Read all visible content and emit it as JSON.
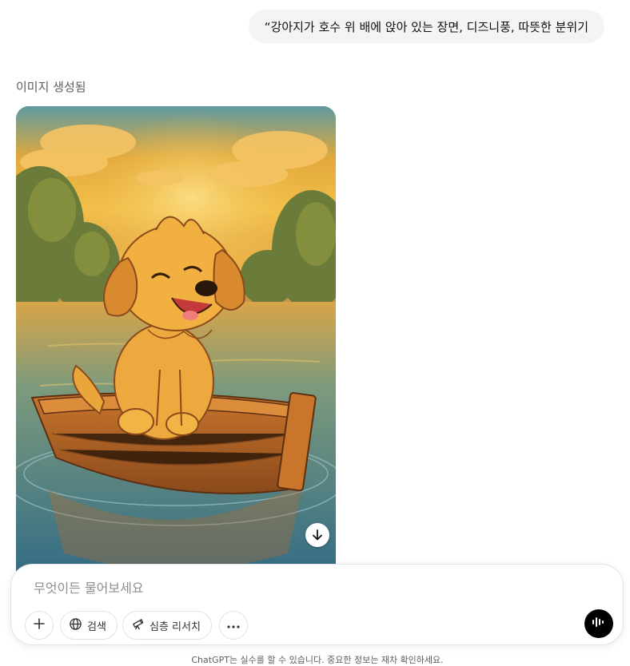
{
  "conversation": {
    "user_message": "“강아지가 호수 위 배에 앉아 있는 장면, 디즈니풍, 따뜻한 분위기",
    "generated_label": "이미지 생성됨",
    "image": {
      "description_icon": "image",
      "download_icon": "arrow-down-icon"
    }
  },
  "composer": {
    "placeholder": "무엇이든 물어보세요",
    "add_icon": "plus-icon",
    "search_label": "검색",
    "search_icon": "globe-icon",
    "research_label": "심층 리서치",
    "research_icon": "telescope-icon",
    "more_icon": "ellipsis-icon",
    "voice_icon": "voice-wave-icon"
  },
  "footer": {
    "disclaimer": "ChatGPT는 실수를 할 수 있습니다. 중요한 정보는 재차 확인하세요."
  },
  "colors": {
    "bubble_bg": "#f4f4f4",
    "voice_button": "#000000",
    "sky_top": "#e6a93a",
    "water": "#2f6f8c"
  }
}
